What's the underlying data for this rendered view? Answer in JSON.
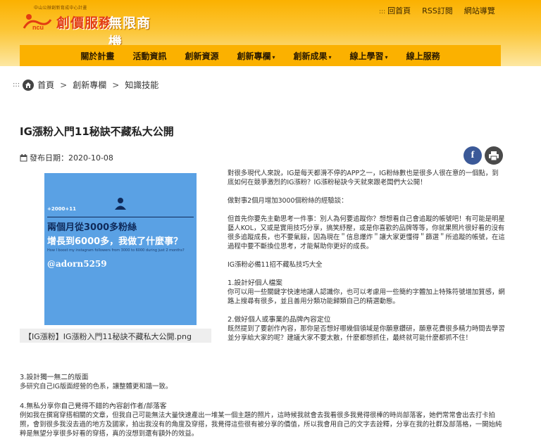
{
  "header": {
    "tagline": "中山公辦創新育成中心計畫",
    "brand_name": "創價服務",
    "brand_sub": "無限商機",
    "toplinks": [
      "回首頁",
      "RSS訂閱",
      "網站導覽"
    ]
  },
  "nav": {
    "items": [
      "關於計畫",
      "活動資訊",
      "創新資源",
      "創新專欄",
      "創新成果",
      "線上學習",
      "線上服務"
    ],
    "dropdowns": [
      false,
      false,
      false,
      true,
      true,
      true,
      false
    ]
  },
  "breadcrumb": {
    "home": "首頁",
    "level1": "創新專欄",
    "level2": "知識技能",
    "separator": ">"
  },
  "article": {
    "title": "IG漲粉入門11秘訣不藏私大公開",
    "date_label": "發布日期：",
    "date": "2020-10-08",
    "share_fb": "f",
    "figure": {
      "followers": "+2000+11",
      "headline1": "兩個月從3000多粉絲",
      "headline2": "增長到6000多，我做了什麼事？",
      "english": "How I boost my instagram followers from 3000 to 6000 during just 2 months?",
      "handle": "@adorn5259",
      "caption": "【IG漲粉】IG漲粉入門11秘訣不藏私大公開.png"
    },
    "p1": "對很多現代人來說，IG是每天都滑不停的APP之一，IG粉絲數也是很多人很在意的一個點，到底如何在競爭激烈的IG漲粉？IG漲粉秘訣今天就來跟老闆們大公開！",
    "p2": "做對事2個月增加3000個粉絲的經驗談：",
    "p3": "但首先你要先主動思考一件事：別人為何要追蹤你？想想看自己會追蹤的帳號吧！有可能是明星藝人KOL，又或是實用技巧分享，搞笑紓壓，或是你喜歡的品牌等等，你就果照片很好看的沒有很多追蹤成長，也不要氣餒，因為現在＂信息爆炸＂讓大家更懂得＂篩選＂所追蹤的帳號，在這過程中要不斷換位思考，才能幫助你更好的成長。",
    "p4": "IG漲粉必備11招不藏私技巧大全",
    "s1_title": "1.設計好個人檔案",
    "s1_body": "你可以用一些關鍵字快速地讓人認識你，也可以考慮用一些簡約字體加上特殊符號增加質感，網路上搜尋有很多，並且善用分類功能歸類自己的精選動態。",
    "s2_title": "2.做好個人或事業的品牌內容定位",
    "s2_body": "既然提到了要創作內容，那你是否想好哪幾個領域是你願意鑽研，願意花費很多精力時間去學習並分享給大家的呢？建議大家不要太散，什麼都想抓住，最終就可能什麼都抓不住！",
    "s3_title": "3.設計獨一無二的版面",
    "s3_body": "多研究自己IG版面經營的色系，讓整體更和諧一致。",
    "s4_title": "4.無私分享你自己覺得不錯的內容創作者/部落客",
    "s4_body": "例如我在撰寫穿搭相關的文章，但我自己可能無法大量快速產出一堆某一個主題的照片，這時候我就會去我看很多我覺得很棒的時尚部落客，她們常常會出去打卡拍照，會到很多我沒去過的地方及國家，拍出我沒有的角度及穿搭，我覺得這些很有被分享的價值，所以我會用自己的文字去詮釋，分享在我的社群及部落格，一開始純粹是無望分享很多好看的穿搭，真的沒想到還有額外的效益。"
  },
  "colors": {
    "header_top": "#fbb100",
    "nav_bg": "#fbb100",
    "brand_red": "#e23d12",
    "figure_bg": "#5aa1e4",
    "fb_blue": "#3b5998"
  }
}
